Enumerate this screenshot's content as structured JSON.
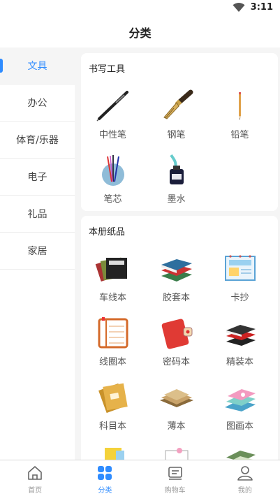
{
  "status": {
    "time": "3:11"
  },
  "header": {
    "title": "分类"
  },
  "sidebar": {
    "items": [
      {
        "label": "文具"
      },
      {
        "label": "办公"
      },
      {
        "label": "体育/乐器"
      },
      {
        "label": "电子"
      },
      {
        "label": "礼品"
      },
      {
        "label": "家居"
      }
    ]
  },
  "sections": [
    {
      "title": "书写工具",
      "items": [
        {
          "label": "中性笔",
          "icon": "gel-pen-icon"
        },
        {
          "label": "钢笔",
          "icon": "fountain-pen-icon"
        },
        {
          "label": "铅笔",
          "icon": "pencil-icon"
        },
        {
          "label": "笔芯",
          "icon": "pen-refill-icon"
        },
        {
          "label": "墨水",
          "icon": "ink-bottle-icon"
        }
      ]
    },
    {
      "title": "本册纸品",
      "items": [
        {
          "label": "车线本",
          "icon": "stitched-notebook-icon"
        },
        {
          "label": "胶套本",
          "icon": "covered-notebook-icon"
        },
        {
          "label": "卡抄",
          "icon": "card-copy-icon"
        },
        {
          "label": "线圈本",
          "icon": "spiral-notebook-icon"
        },
        {
          "label": "密码本",
          "icon": "lock-notebook-icon"
        },
        {
          "label": "精装本",
          "icon": "hardcover-notebook-icon"
        },
        {
          "label": "科目本",
          "icon": "subject-notebook-icon"
        },
        {
          "label": "薄本",
          "icon": "thin-notebook-icon"
        },
        {
          "label": "图画本",
          "icon": "drawing-book-icon"
        }
      ]
    }
  ],
  "bottom_nav": {
    "items": [
      {
        "label": "首页",
        "icon": "home-icon"
      },
      {
        "label": "分类",
        "icon": "category-icon"
      },
      {
        "label": "购物车",
        "icon": "cart-icon"
      },
      {
        "label": "我的",
        "icon": "user-icon"
      }
    ]
  },
  "colors": {
    "accent": "#2f8cff",
    "background": "#f5f5f5"
  }
}
